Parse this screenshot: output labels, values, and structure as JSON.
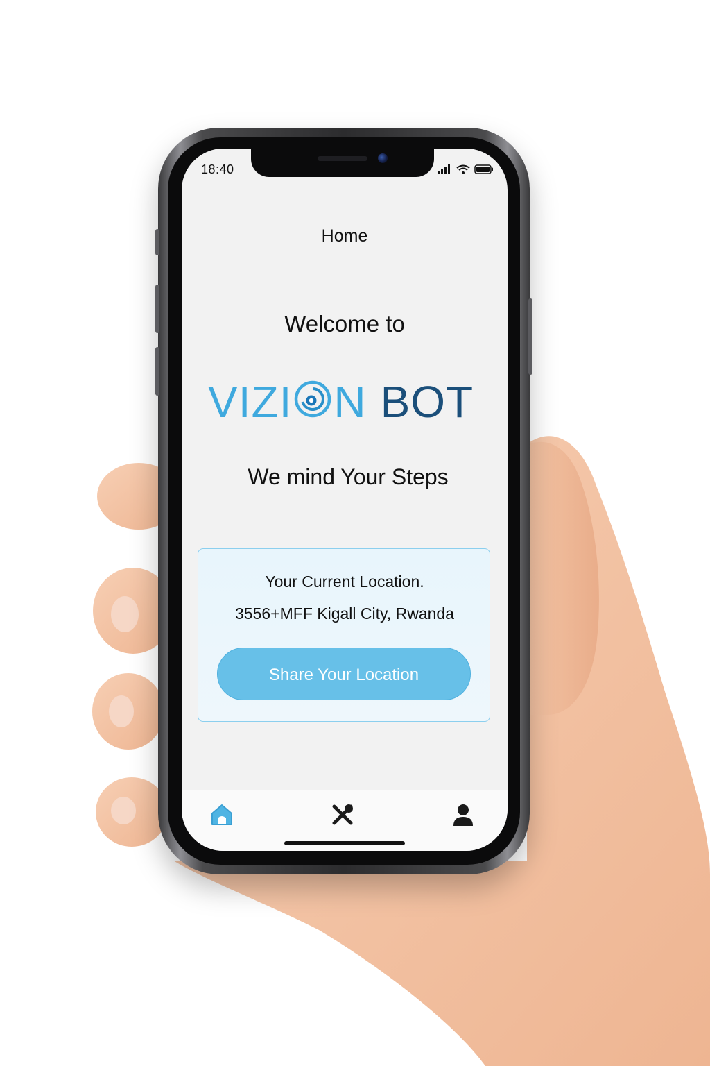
{
  "status_bar": {
    "time": "18:40",
    "icons": [
      "signal-icon",
      "wifi-icon",
      "battery-icon"
    ]
  },
  "header": {
    "title": "Home"
  },
  "hero": {
    "welcome": "Welcome to",
    "brand_part1_a": "VIZI",
    "brand_part1_b": "N",
    "brand_part2": "BOT",
    "tagline": "We mind Your Steps"
  },
  "location_card": {
    "label": "Your Current Location.",
    "address": "3556+MFF Kigall City, Rwanda",
    "share_button": "Share Your Location"
  },
  "tab_bar": {
    "items": [
      {
        "icon": "home-icon",
        "active": true
      },
      {
        "icon": "tools-icon",
        "active": false
      },
      {
        "icon": "profile-icon",
        "active": false
      }
    ]
  },
  "colors": {
    "accent": "#67c0e8",
    "brand_light": "#3fa9de",
    "brand_dark": "#1b4f7a",
    "card_border": "#8ccfee",
    "screen_bg": "#f2f2f2"
  }
}
